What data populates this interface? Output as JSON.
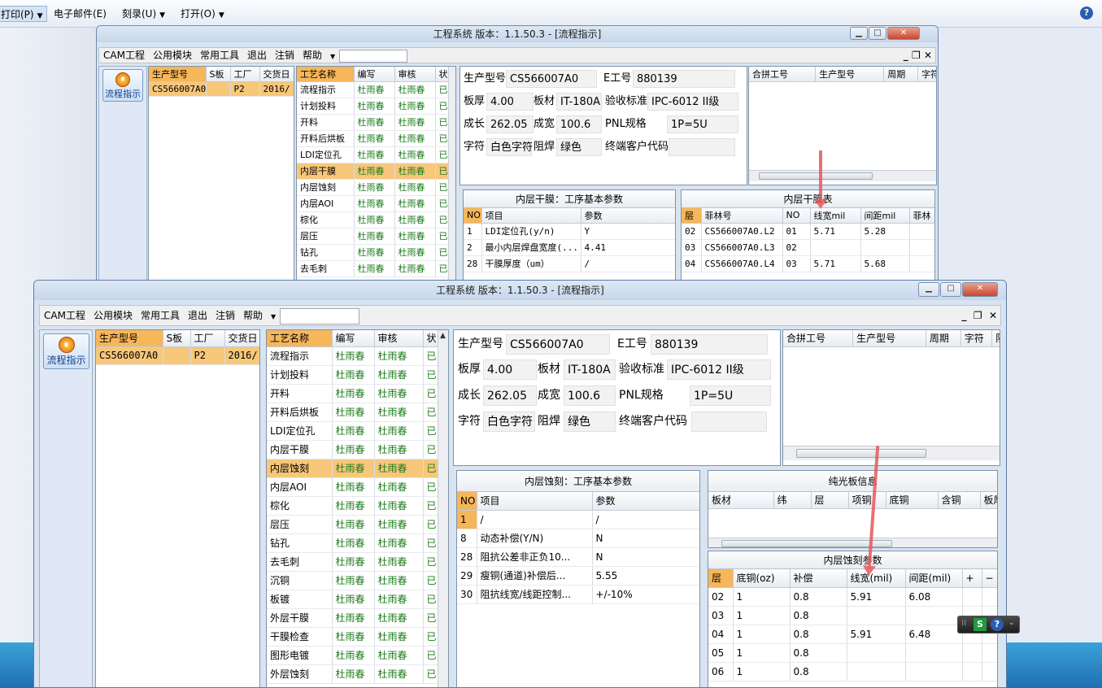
{
  "toolbar": {
    "print": "打印(P)",
    "email": "电子邮件(E)",
    "burn": "刻录(U)",
    "open": "打开(O)",
    "help": "?"
  },
  "window": {
    "title": "工程系统  版本：1.1.50.3 - [流程指示]",
    "min": "▁",
    "max": "□",
    "close": "✕"
  },
  "menu": {
    "items": [
      "CAM工程",
      "公用模块",
      "常用工具",
      "退出",
      "注销",
      "帮助"
    ],
    "ctrl_min": "_",
    "ctrl_restore": "❐",
    "ctrl_close": "✕"
  },
  "nav": {
    "button": "流程指示"
  },
  "models": {
    "headers": [
      "生产型号",
      "S板",
      "工厂",
      "交货日"
    ],
    "rows": [
      [
        "CS566007A0",
        "",
        "P2",
        "2016/"
      ]
    ]
  },
  "processes": {
    "headers": [
      "工艺名称",
      "编写",
      "审核",
      "状"
    ],
    "rows": [
      [
        "流程指示",
        "杜雨春",
        "杜雨春",
        "已"
      ],
      [
        "计划投料",
        "杜雨春",
        "杜雨春",
        "已"
      ],
      [
        "开料",
        "杜雨春",
        "杜雨春",
        "已"
      ],
      [
        "开料后烘板",
        "杜雨春",
        "杜雨春",
        "已"
      ],
      [
        "LDI定位孔",
        "杜雨春",
        "杜雨春",
        "已"
      ],
      [
        "内层干膜",
        "杜雨春",
        "杜雨春",
        "已"
      ],
      [
        "内层蚀刻",
        "杜雨春",
        "杜雨春",
        "已"
      ],
      [
        "内层AOI",
        "杜雨春",
        "杜雨春",
        "已"
      ],
      [
        "棕化",
        "杜雨春",
        "杜雨春",
        "已"
      ],
      [
        "层压",
        "杜雨春",
        "杜雨春",
        "已"
      ],
      [
        "钻孔",
        "杜雨春",
        "杜雨春",
        "已"
      ],
      [
        "去毛刺",
        "杜雨春",
        "杜雨春",
        "已"
      ],
      [
        "沉铜",
        "杜雨春",
        "杜雨春",
        "已"
      ],
      [
        "板镀",
        "杜雨春",
        "杜雨春",
        "已"
      ],
      [
        "外层干膜",
        "杜雨春",
        "杜雨春",
        "已"
      ],
      [
        "干膜检查",
        "杜雨春",
        "杜雨春",
        "已"
      ],
      [
        "图形电镀",
        "杜雨春",
        "杜雨春",
        "已"
      ],
      [
        "外层蚀刻",
        "杜雨春",
        "杜雨春",
        "已"
      ]
    ]
  },
  "info": {
    "model_label": "生产型号",
    "model": "CS566007A0",
    "eno_label": "E工号",
    "eno": "880139",
    "thick_label": "板厚",
    "thick": "4.00",
    "mat_label": "板材",
    "mat": "IT-180A",
    "std_label": "验收标准",
    "std": "IPC-6012 II级",
    "len_label": "成长",
    "len": "262.05",
    "wid_label": "成宽",
    "wid": "100.6",
    "pnl_label": "PNL规格",
    "pnl": "1P=5U",
    "char_label": "字符",
    "char": "白色字符",
    "mask_label": "阻焊",
    "mask": "绿色",
    "cust_label": "终端客户代码",
    "cust": ""
  },
  "merge": {
    "headers": [
      "合拼工号",
      "生产型号",
      "周期",
      "字符",
      "阻焊"
    ]
  },
  "back": {
    "param_title": "内层干膜：工序基本参数",
    "param_headers": [
      "NO",
      "项目",
      "参数"
    ],
    "params": [
      [
        "1",
        "LDI定位孔(y/n)",
        "Y"
      ],
      [
        "2",
        "最小内层焊盘宽度(...",
        "4.41"
      ],
      [
        "28",
        "干膜厚度（um）",
        "/"
      ]
    ],
    "layer_title": "内层干膜表",
    "layer_headers": [
      "层",
      "菲林号",
      "NO",
      "线宽mil",
      "间距mil",
      "菲林"
    ],
    "layers": [
      [
        "02",
        "CS566007A0.L2",
        "01",
        "5.71",
        "5.28",
        ""
      ],
      [
        "03",
        "CS566007A0.L3",
        "02",
        "",
        "",
        ""
      ],
      [
        "04",
        "CS566007A0.L4",
        "03",
        "5.71",
        "5.68",
        ""
      ]
    ]
  },
  "front": {
    "param_title": "内层蚀刻：工序基本参数",
    "param_headers": [
      "NO",
      "项目",
      "参数"
    ],
    "params": [
      [
        "1",
        "/",
        "/"
      ],
      [
        "8",
        "动态补偿(Y/N)",
        "N"
      ],
      [
        "28",
        "阻抗公差非正负10...",
        "N"
      ],
      [
        "29",
        "瘦铜(通道)补偿后...",
        "5.55"
      ],
      [
        "30",
        "阻抗线宽/线距控制...",
        "+/-10%"
      ]
    ],
    "pure_title": "纯光板信息",
    "pure_headers": [
      "板材",
      "纬",
      "层",
      "项铜",
      "底铜",
      "含铜",
      "板厚"
    ],
    "etch_title": "内层蚀刻参数",
    "etch_headers": [
      "层",
      "底铜(oz)",
      "补偿",
      "线宽(mil)",
      "间距(mil)",
      "+",
      "−"
    ],
    "etch": [
      [
        "02",
        "1",
        "0.8",
        "5.91",
        "6.08",
        "",
        ""
      ],
      [
        "03",
        "1",
        "0.8",
        "",
        "",
        "",
        ""
      ],
      [
        "04",
        "1",
        "0.8",
        "5.91",
        "6.48",
        "",
        ""
      ],
      [
        "05",
        "1",
        "0.8",
        "",
        "",
        "",
        ""
      ],
      [
        "06",
        "1",
        "0.8",
        "",
        "",
        "",
        ""
      ]
    ]
  },
  "ime": {
    "s": "S",
    "q": "?"
  },
  "colors": {
    "selected": "#f7c77a",
    "header_first": "#f6b65a",
    "green_text": "#1c7a1c",
    "arrow": "#e8585a"
  }
}
